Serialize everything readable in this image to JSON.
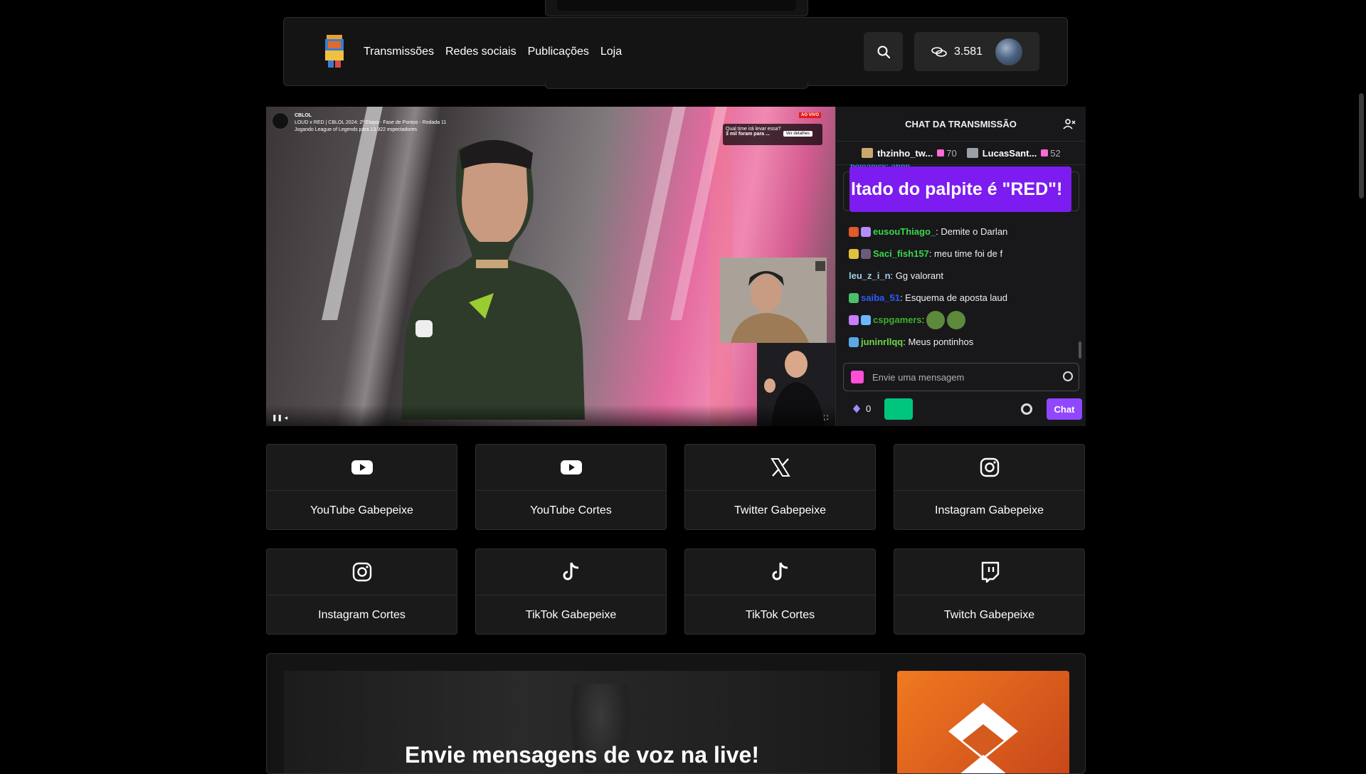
{
  "header": {
    "nav": [
      "Transmissões",
      "Redes sociais",
      "Publicações",
      "Loja"
    ],
    "points": "3.581"
  },
  "video": {
    "channel": "CBLOL",
    "title": "LOUD x RED | CBLOL 2024: 2ª Etapa - Fase de Pontos - Rodada 11",
    "subtitle": "Jogando League of Legends para 13.922 espectadores",
    "live_badge": "AO VIVO",
    "poll_question": "Qual time irá levar essa?",
    "poll_votes": "3 mil foram para ...",
    "poll_button": "Ver detalhes"
  },
  "chat": {
    "title": "CHAT DA TRANSMISSÃO",
    "gifters": [
      {
        "name": "thzinho_tw...",
        "count": "70"
      },
      {
        "name": "LucasSant...",
        "count": "52"
      }
    ],
    "cut_message": "boleanick: ahnn",
    "poll_result": "ltado do palpite é \"RED\"!",
    "messages": [
      {
        "user": "eusouThiago_",
        "text": ": Demite o Darlan",
        "color": "#38d84b"
      },
      {
        "user": "Saci_fish157",
        "text": ": meu time foi de f",
        "color": "#38d84b"
      },
      {
        "user": "leu_z_i_n",
        "text": ": Gg valorant",
        "color": "#9ecfe8"
      },
      {
        "user": "saiba_51",
        "text": ": Esquema de aposta laud",
        "color": "#2b5bff"
      },
      {
        "user": "cspgamers",
        "text": ":",
        "color": "#3fae2b"
      },
      {
        "user": "juninrllqq",
        "text": ": Meus pontinhos",
        "color": "#6fd64a"
      }
    ],
    "input_placeholder": "Envie uma mensagem",
    "channel_points": "0",
    "chat_button": "Chat"
  },
  "socials": [
    {
      "label": "YouTube Gabepeixe",
      "icon": "youtube-icon"
    },
    {
      "label": "YouTube Cortes",
      "icon": "youtube-icon"
    },
    {
      "label": "Twitter Gabepeixe",
      "icon": "x-twitter-icon"
    },
    {
      "label": "Instagram Gabepeixe",
      "icon": "instagram-icon"
    },
    {
      "label": "Instagram Cortes",
      "icon": "instagram-icon"
    },
    {
      "label": "TikTok Gabepeixe",
      "icon": "tiktok-icon"
    },
    {
      "label": "TikTok Cortes",
      "icon": "tiktok-icon"
    },
    {
      "label": "Twitch Gabepeixe",
      "icon": "twitch-icon"
    }
  ],
  "promo": {
    "title": "Envie mensagens de voz na live!"
  },
  "colors": {
    "accent_purple": "#9147ff",
    "poll_purple": "#7c1cf0",
    "green_button": "#00c67d",
    "promo_orange": "#f07a20"
  }
}
